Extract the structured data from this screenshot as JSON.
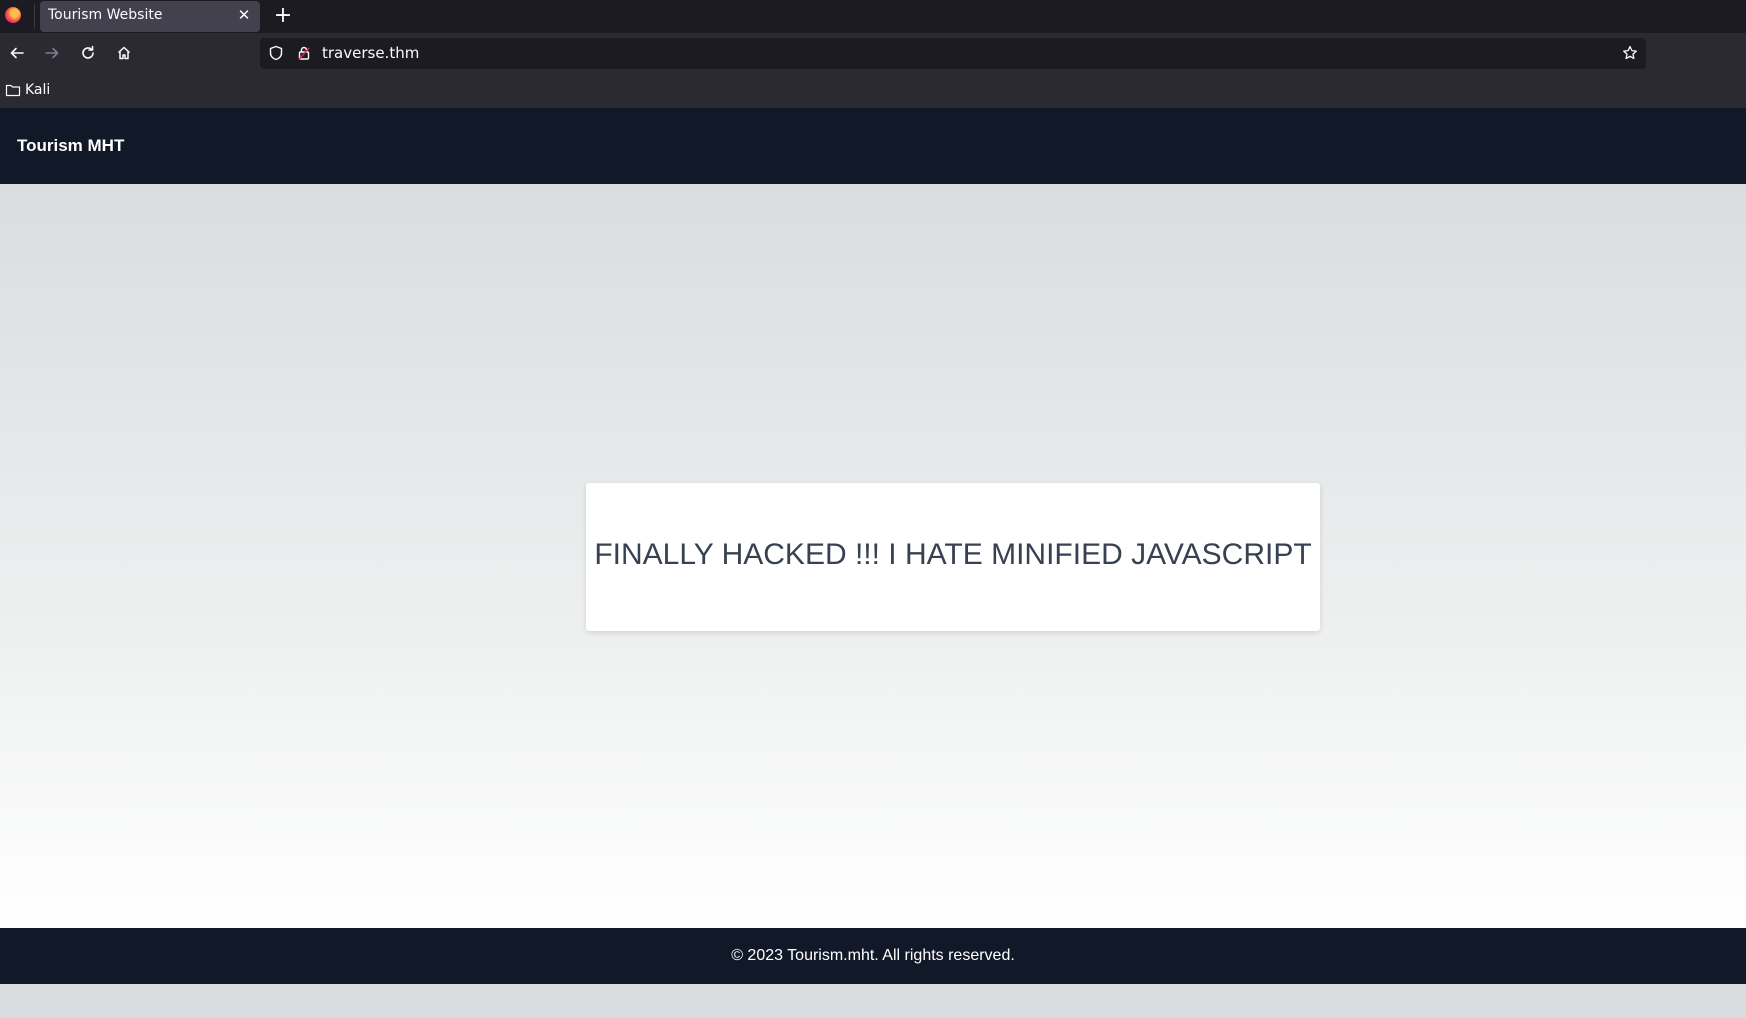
{
  "browser": {
    "tab": {
      "title": "Tourism Website",
      "close_icon": "close-icon"
    },
    "new_tab_label": "+",
    "nav": {
      "back_icon": "back-arrow-icon",
      "forward_icon": "forward-arrow-icon",
      "reload_icon": "reload-icon",
      "home_icon": "home-icon"
    },
    "url": "traverse.thm",
    "bookmarks": [
      {
        "label": "Kali",
        "icon": "folder-icon"
      }
    ]
  },
  "site": {
    "header_title": "Tourism MHT",
    "message": "FINALLY HACKED !!! I HATE MINIFIED JAVASCRIPT",
    "footer": "© 2023 Tourism.mht. All rights reserved."
  },
  "colors": {
    "header_bg": "#111827",
    "message_text": "#374151",
    "chrome_bg": "#1c1b22",
    "toolbar_bg": "#2b2a33"
  }
}
